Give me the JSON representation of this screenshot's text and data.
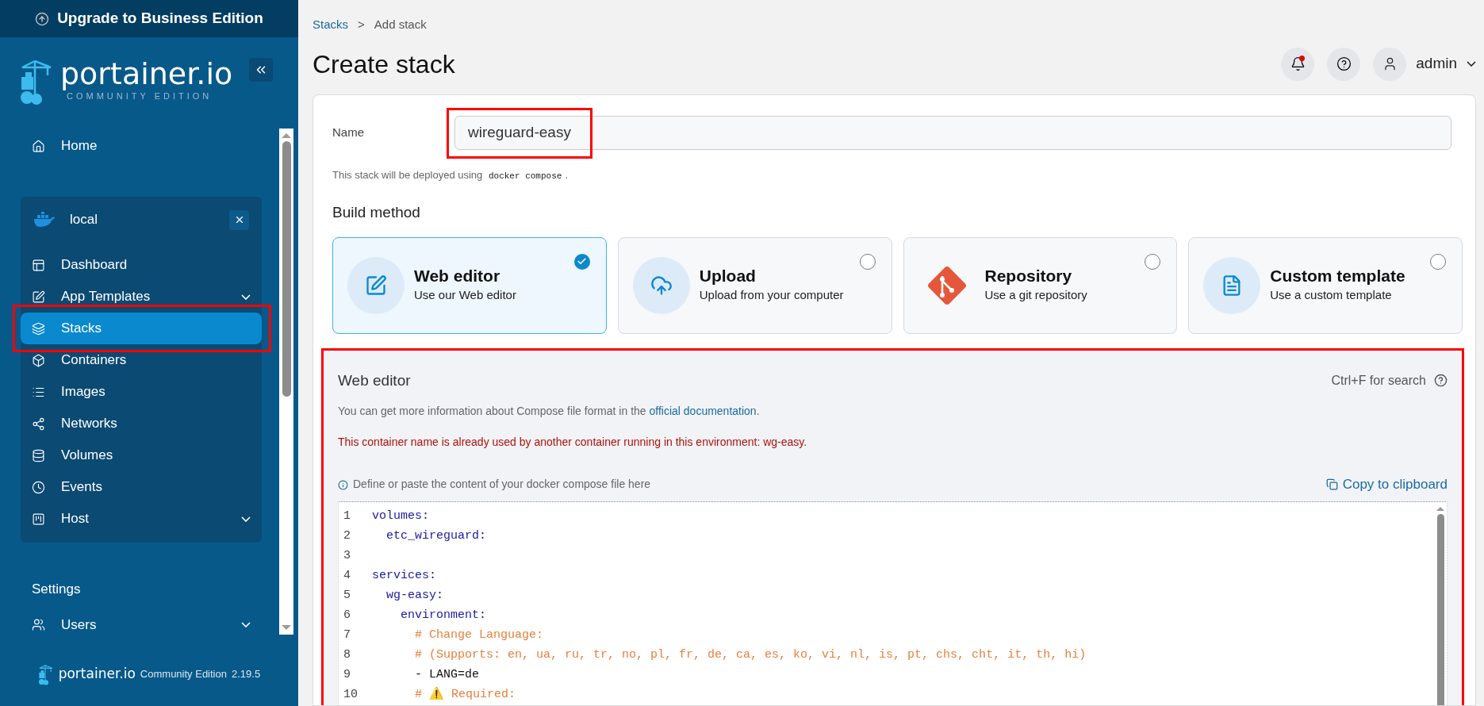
{
  "sidebar": {
    "upgrade": "Upgrade to Business Edition",
    "logo": {
      "name": "portainer.io",
      "edition": "COMMUNITY EDITION"
    },
    "home": {
      "label": "Home",
      "selected": false
    },
    "environment": {
      "name": "local",
      "items": [
        {
          "label": "Dashboard",
          "selected": false,
          "expandable": false
        },
        {
          "label": "App Templates",
          "selected": false,
          "expandable": true
        },
        {
          "label": "Stacks",
          "selected": true,
          "expandable": false,
          "highlighted": true
        },
        {
          "label": "Containers",
          "selected": false,
          "expandable": false
        },
        {
          "label": "Images",
          "selected": false,
          "expandable": false
        },
        {
          "label": "Networks",
          "selected": false,
          "expandable": false
        },
        {
          "label": "Volumes",
          "selected": false,
          "expandable": false
        },
        {
          "label": "Events",
          "selected": false,
          "expandable": false
        },
        {
          "label": "Host",
          "selected": false,
          "expandable": true
        }
      ]
    },
    "settings_heading": "Settings",
    "settings_items": [
      {
        "label": "Users",
        "selected": false,
        "expandable": true
      }
    ],
    "footer": {
      "brand": "portainer.io",
      "edition": "Community Edition",
      "version": "2.19.5"
    }
  },
  "header": {
    "breadcrumb": [
      {
        "label": "Stacks",
        "link": true
      },
      {
        "label": "Add stack",
        "link": false
      }
    ],
    "separator": ">",
    "title": "Create stack",
    "notifications": true,
    "user": "admin"
  },
  "form": {
    "name_label": "Name",
    "name_value": "wireguard-easy",
    "name_highlighted": true,
    "hint": {
      "before": "This stack will be deployed using",
      "code": "docker compose",
      "after": "."
    },
    "build_method_heading": "Build method",
    "build_methods": [
      {
        "title": "Web editor",
        "subtitle": "Use our Web editor",
        "selected": true
      },
      {
        "title": "Upload",
        "subtitle": "Upload from your computer",
        "selected": false
      },
      {
        "title": "Repository",
        "subtitle": "Use a git repository",
        "selected": false
      },
      {
        "title": "Custom template",
        "subtitle": "Use a custom template",
        "selected": false
      }
    ]
  },
  "editor": {
    "heading": "Web editor",
    "search_hint": "Ctrl+F for search",
    "highlighted": true,
    "info": {
      "text": "You can get more information about Compose file format in the",
      "link": "official documentation",
      "after": "."
    },
    "error": "This container name is already used by another container running in this environment: wg-easy.",
    "define_hint": "Define or paste the content of your docker compose file here",
    "copy": "Copy to clipboard",
    "lines": [
      {
        "number": "1",
        "text": "volumes:",
        "kind": "key"
      },
      {
        "number": "2",
        "text": "  etc_wireguard:",
        "kind": "key"
      },
      {
        "number": "3"
      },
      {
        "number": "4",
        "text": "services:",
        "kind": "key"
      },
      {
        "number": "5",
        "text": "  wg-easy:",
        "kind": "key"
      },
      {
        "number": "6",
        "text": "    environment:",
        "kind": "key"
      },
      {
        "number": "7",
        "text": "      # Change Language:",
        "kind": "comment"
      },
      {
        "number": "8",
        "text": "      # (Supports: en, ua, ru, tr, no, pl, fr, de, ca, es, ko, vi, nl, is, pt, chs, cht, it, th, hi)",
        "kind": "comment"
      },
      {
        "number": "9",
        "text": "      - LANG=de",
        "kind": "plain"
      },
      {
        "number": "10",
        "text": "      # ⚠️ Required:",
        "kind": "comment"
      }
    ]
  }
}
